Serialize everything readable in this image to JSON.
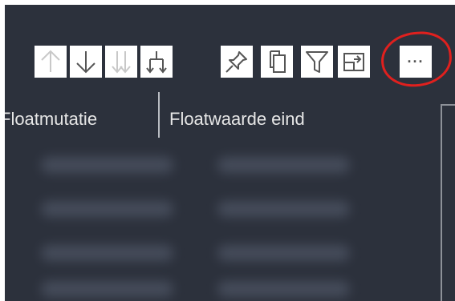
{
  "table": {
    "columns": [
      {
        "label": "Floatmutatie"
      },
      {
        "label": "Floatwaarde eind"
      }
    ]
  },
  "toolbar": {
    "buttons": [
      {
        "name": "drill-up",
        "icon": "arrow-up-icon",
        "enabled": false
      },
      {
        "name": "drill-down",
        "icon": "arrow-down-icon",
        "enabled": true
      },
      {
        "name": "go-to-next-level",
        "icon": "double-arrow-down-icon",
        "enabled": false
      },
      {
        "name": "expand-next-level",
        "icon": "hierarchy-expand-icon",
        "enabled": true
      },
      {
        "name": "pin-visual",
        "icon": "pin-icon",
        "enabled": true
      },
      {
        "name": "copy-visual",
        "icon": "copy-icon",
        "enabled": true
      },
      {
        "name": "filter-visual",
        "icon": "filter-icon",
        "enabled": true
      },
      {
        "name": "focus-mode",
        "icon": "focus-mode-icon",
        "enabled": true
      },
      {
        "name": "more-options",
        "icon": "ellipsis-icon",
        "enabled": true
      }
    ],
    "more_options_label": "···"
  },
  "colors": {
    "canvas": "#2c313c",
    "toolbar_button": "#ffffff",
    "icon_enabled": "#555555",
    "icon_disabled": "#c8c8c8",
    "header_text": "#e6e6e6",
    "annotation": "#e0201e"
  }
}
